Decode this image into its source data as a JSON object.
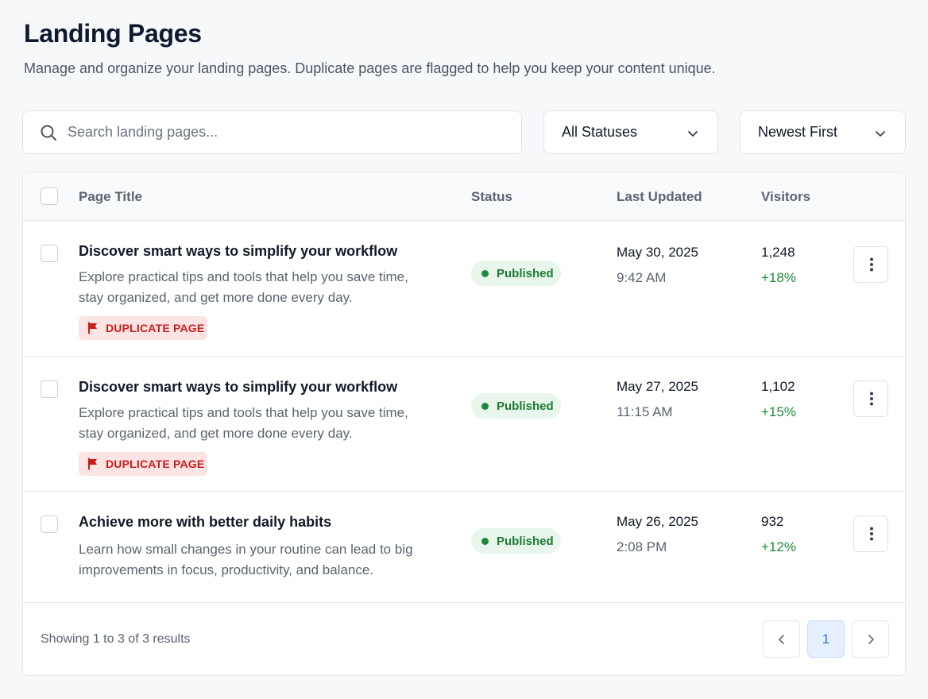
{
  "header": {
    "title": "Landing Pages",
    "subtitle": "Manage and organize your landing pages. Duplicate pages are flagged to help you keep your content unique."
  },
  "toolbar": {
    "search_placeholder": "Search landing pages...",
    "status_filter": "All Statuses",
    "sort": "Newest First"
  },
  "table": {
    "columns": {
      "title": "Page Title",
      "status": "Status",
      "updated": "Last Updated",
      "visitors": "Visitors"
    },
    "rows": [
      {
        "title": "Discover smart ways to simplify your workflow",
        "description": "Explore practical tips and tools that help you save time, stay organized, and get more done every day.",
        "badge": "DUPLICATE PAGE",
        "status": "Published",
        "date": "May 30, 2025",
        "time": "9:42 AM",
        "visitors": "1,248",
        "change": "+18%"
      },
      {
        "title": "Discover smart ways to simplify your workflow",
        "description": "Explore practical tips and tools that help you save time, stay organized, and get more done every day.",
        "badge": "DUPLICATE PAGE",
        "status": "Published",
        "date": "May 27, 2025",
        "time": "11:15 AM",
        "visitors": "1,102",
        "change": "+15%"
      },
      {
        "title": "Achieve more with better daily habits",
        "description": "Learn how small changes in your routine can lead to big improvements in focus, productivity, and balance.",
        "status": "Published",
        "date": "May 26, 2025",
        "time": "2:08 PM",
        "visitors": "932",
        "change": "+12%"
      }
    ]
  },
  "footer": {
    "results_text": "Showing 1 to 3 of 3 results",
    "current_page": "1"
  },
  "colors": {
    "accent": "#2f6fdb",
    "duplicate": "#c81e1e",
    "published": "#1f8a3c"
  }
}
